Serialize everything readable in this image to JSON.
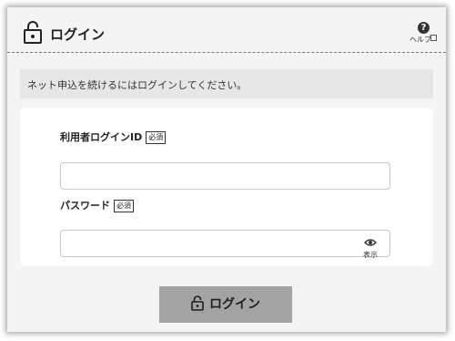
{
  "header": {
    "title": "ログイン",
    "help_label": "ヘルプ"
  },
  "notice": "ネット申込を続けるにはログインしてください。",
  "form": {
    "login_id_label": "利用者ログインID",
    "password_label": "パスワード",
    "required_badge": "必須",
    "login_id_value": "",
    "password_value": "",
    "show_password_label": "表示"
  },
  "submit": {
    "label": "ログイン"
  },
  "icons": {
    "header_icon": "lock-icon",
    "help_icon": "question-icon",
    "toggle_icon": "eye-icon",
    "button_icon": "lock-icon"
  },
  "colors": {
    "button_background": "#a3a3a3",
    "notice_background": "#e6e6e6",
    "panel_background": "#f4f4f4"
  }
}
